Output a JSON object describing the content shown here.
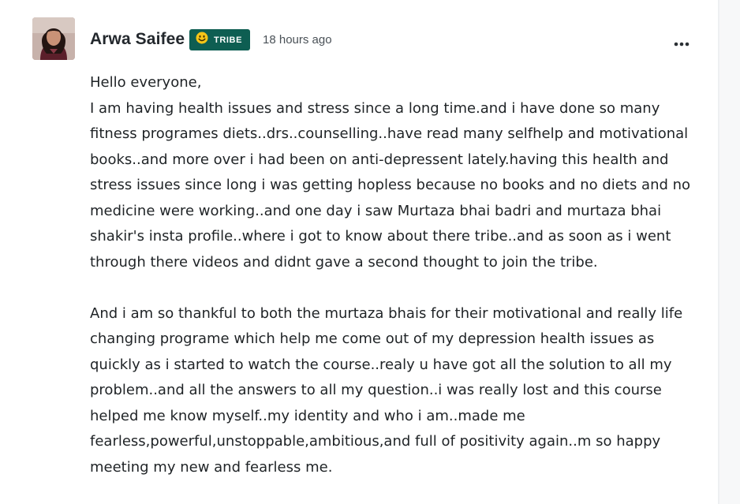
{
  "post": {
    "author": {
      "name": "Arwa Saifee",
      "avatar_icon": "user-avatar-photo"
    },
    "badge": {
      "icon": "smiley-face-icon",
      "label": "TRIBE",
      "color": "#0e5e52"
    },
    "timestamp": "18 hours ago",
    "more_icon": "more-options-icon",
    "paragraphs": [
      "Hello everyone,\nI am having health issues and stress since a long time.and i have done so many fitness programes diets..drs..counselling..have read many selfhelp and motivational books..and more over i had been on anti-depressent lately.having this health and stress issues since long i was getting hopless because no books and no diets and no medicine were working..and one day i saw Murtaza bhai badri and murtaza bhai shakir's insta profile..where i got to know about there tribe..and as soon as i went through there videos and didnt gave a second thought to join the tribe.",
      "And i am so thankful to both the murtaza bhais for their motivational and really life changing programe which help me come out of my depression health issues as quickly as i started to watch the course..realy u have got all the solution to all my problem..and all the answers to all my question..i was really lost and this course helped me know myself..my identity and who i am..made me fearless,powerful,unstoppable,ambitious,and full of positivity again..m so happy meeting my new and fearless me."
    ]
  }
}
